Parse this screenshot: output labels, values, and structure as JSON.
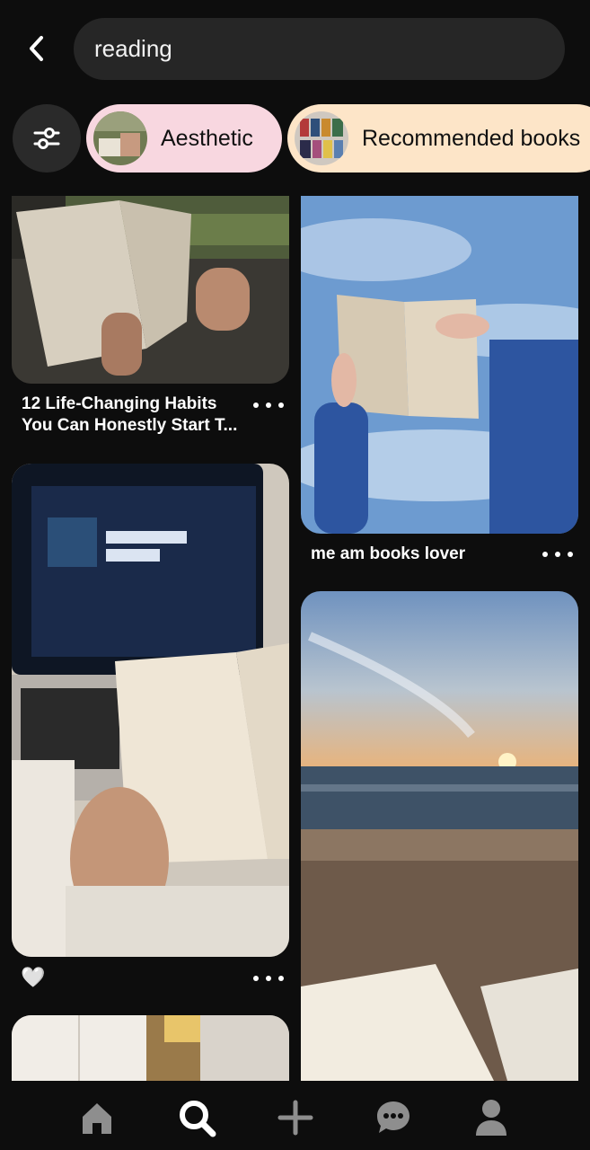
{
  "search": {
    "query": "reading"
  },
  "chips": [
    {
      "label": "Aesthetic",
      "color": "#f8d7e0"
    },
    {
      "label": "Recommended books",
      "color": "#fde5c8"
    }
  ],
  "pins": [
    {
      "title": "12 Life-Changing Habits You Can Honestly Start T...",
      "image": "train-window-book-photo"
    },
    {
      "title": "",
      "reaction": "🤍",
      "image": "laptop-reading-on-a-rainy-night-photo"
    },
    {
      "title": "me am books lover",
      "image": "book-held-against-sky-photo"
    },
    {
      "title": "",
      "image": "beach-sunset-book-photo"
    },
    {
      "title": "",
      "image": "room-interior-photo"
    }
  ],
  "nav": [
    "home-icon",
    "search-icon",
    "plus-icon",
    "chat-icon",
    "profile-icon"
  ],
  "colors": {
    "background": "#0d0d0d",
    "surface": "#262626",
    "icon_inactive": "#8e8e8e",
    "icon_active": "#ffffff"
  }
}
